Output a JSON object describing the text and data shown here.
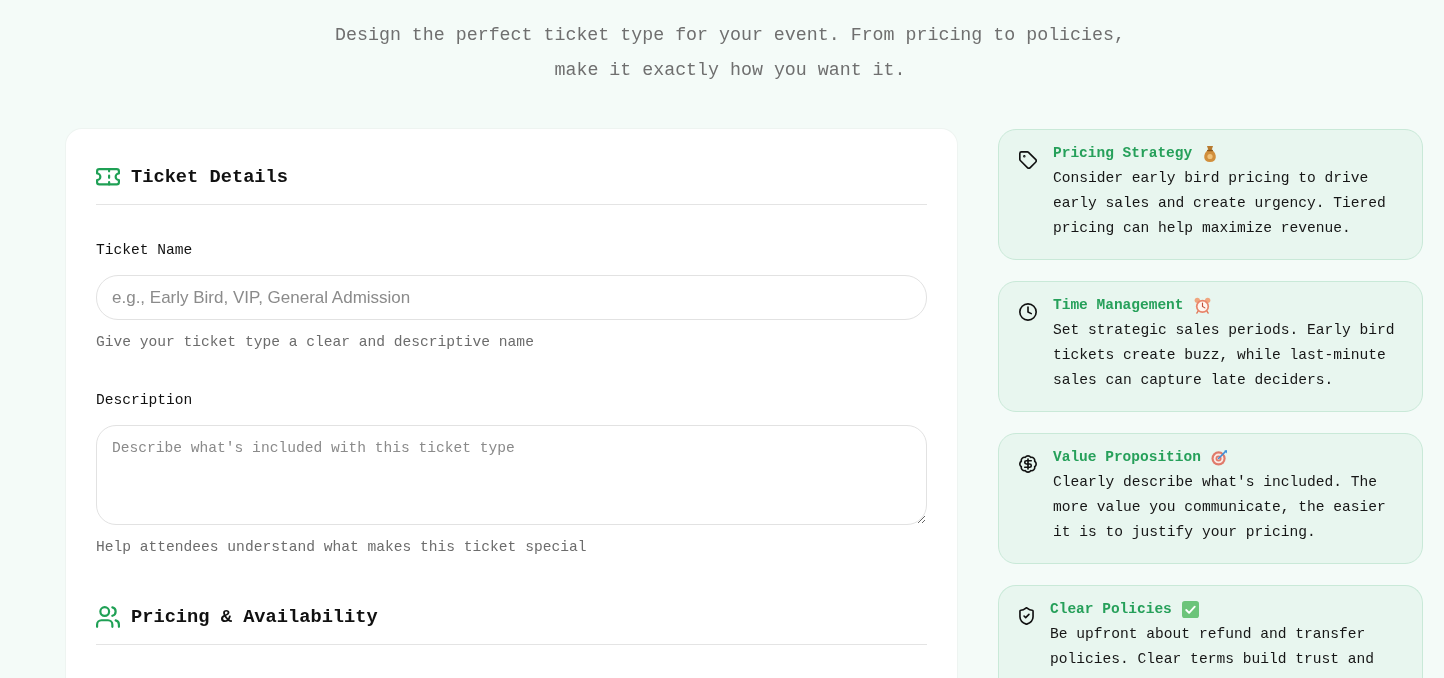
{
  "subtitle": "Design the perfect ticket type for your event. From pricing to policies, make it exactly how you want it.",
  "form": {
    "sections": [
      {
        "kind": "ticket",
        "title": "Ticket Details",
        "fields": [
          {
            "kind": "text",
            "label": "Ticket Name",
            "placeholder": "e.g., Early Bird, VIP, General Admission",
            "help": "Give your ticket type a clear and descriptive name"
          },
          {
            "kind": "textarea",
            "label": "Description",
            "placeholder": "Describe what's included with this ticket type",
            "help": "Help attendees understand what makes this ticket special"
          }
        ]
      },
      {
        "kind": "people",
        "title": "Pricing & Availability"
      }
    ]
  },
  "tips": [
    {
      "kind": "pricing",
      "title": "Pricing Strategy",
      "text": "Consider early bird pricing to drive early sales and create urgency. Tiered pricing can help maximize revenue."
    },
    {
      "kind": "time",
      "title": "Time Management",
      "text": "Set strategic sales periods. Early bird tickets create buzz, while last-minute sales can capture late deciders."
    },
    {
      "kind": "value",
      "title": "Value Proposition",
      "text": "Clearly describe what's included. The more value you communicate, the easier it is to justify your pricing."
    },
    {
      "kind": "policy",
      "title": "Clear Policies",
      "text": "Be upfront about refund and transfer policies. Clear terms build trust and"
    }
  ]
}
